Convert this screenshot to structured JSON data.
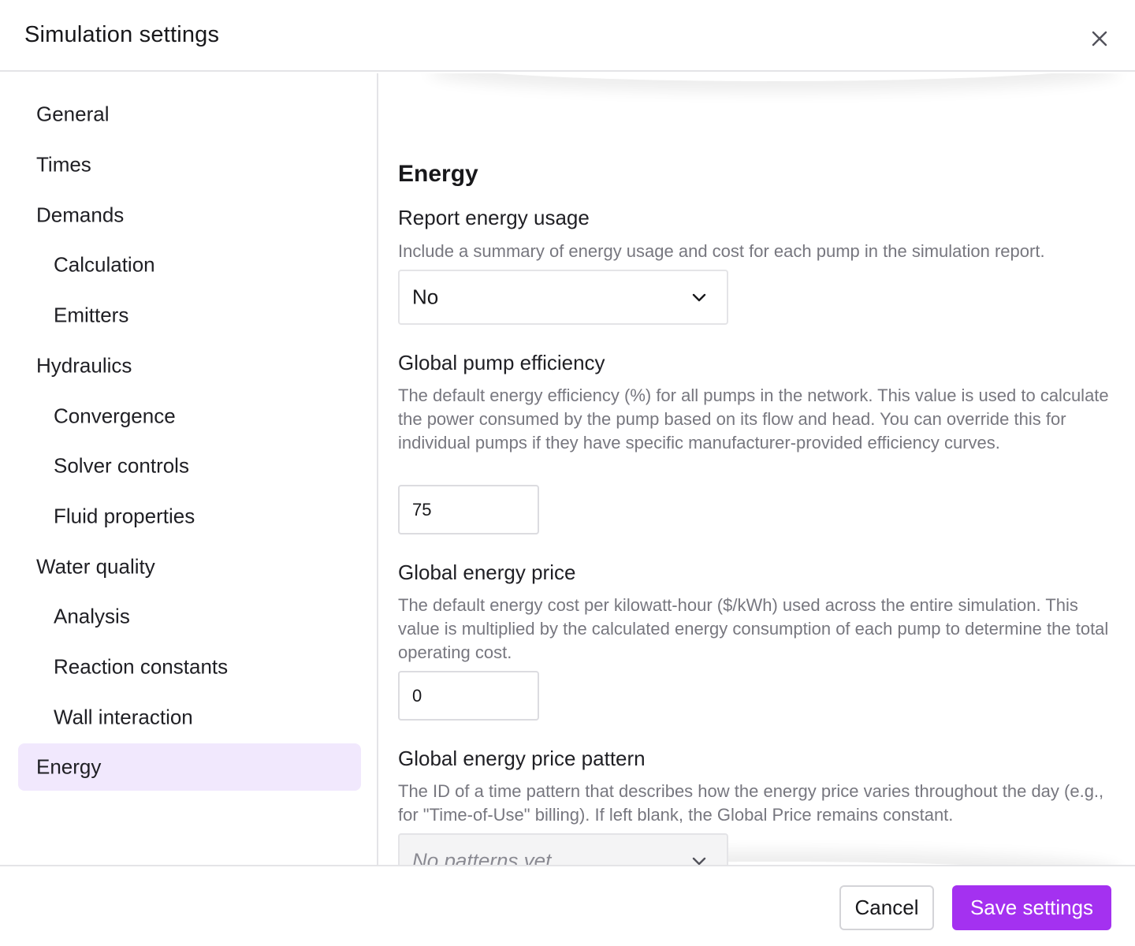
{
  "dialog": {
    "title": "Simulation settings"
  },
  "sidebar": {
    "items": [
      {
        "label": "General",
        "level": "top",
        "active": false
      },
      {
        "label": "Times",
        "level": "top",
        "active": false
      },
      {
        "label": "Demands",
        "level": "top",
        "active": false
      },
      {
        "label": "Calculation",
        "level": "sub",
        "active": false
      },
      {
        "label": "Emitters",
        "level": "sub",
        "active": false
      },
      {
        "label": "Hydraulics",
        "level": "top",
        "active": false
      },
      {
        "label": "Convergence",
        "level": "sub",
        "active": false
      },
      {
        "label": "Solver controls",
        "level": "sub",
        "active": false
      },
      {
        "label": "Fluid properties",
        "level": "sub",
        "active": false
      },
      {
        "label": "Water quality",
        "level": "top",
        "active": false
      },
      {
        "label": "Analysis",
        "level": "sub",
        "active": false
      },
      {
        "label": "Reaction constants",
        "level": "sub",
        "active": false
      },
      {
        "label": "Wall interaction",
        "level": "sub",
        "active": false
      },
      {
        "label": "Energy",
        "level": "top",
        "active": true
      }
    ]
  },
  "main": {
    "section_title": "Energy",
    "report_energy": {
      "label": "Report energy usage",
      "description": "Include a summary of energy usage and cost for each pump in the simulation report.",
      "value": "No"
    },
    "pump_efficiency": {
      "label": "Global pump efficiency",
      "description": "The default energy efficiency (%) for all pumps in the network. This value is used to calculate the power consumed by the pump based on its flow and head. You can override this for individual pumps if they have specific manufacturer-provided efficiency curves.",
      "value": "75"
    },
    "energy_price": {
      "label": "Global energy price",
      "description": "The default energy cost per kilowatt-hour ($/kWh) used across the entire simulation. This value is multiplied by the calculated energy consumption of each pump to determine the total operating cost.",
      "value": "0"
    },
    "price_pattern": {
      "label": "Global energy price pattern",
      "description": "The ID of a time pattern that describes how the energy price varies throughout the day (e.g., for \"Time-of-Use\" billing). If left blank, the Global Price remains constant.",
      "value": "No patterns yet"
    }
  },
  "footer": {
    "cancel_label": "Cancel",
    "save_label": "Save settings"
  },
  "colors": {
    "accent": "#a431f0",
    "active_nav_bg": "#f1e8fd",
    "muted_text": "#77777f",
    "border": "#e4e4e7"
  },
  "icons": {
    "close": "close-icon",
    "chevron": "chevron-down-icon"
  }
}
